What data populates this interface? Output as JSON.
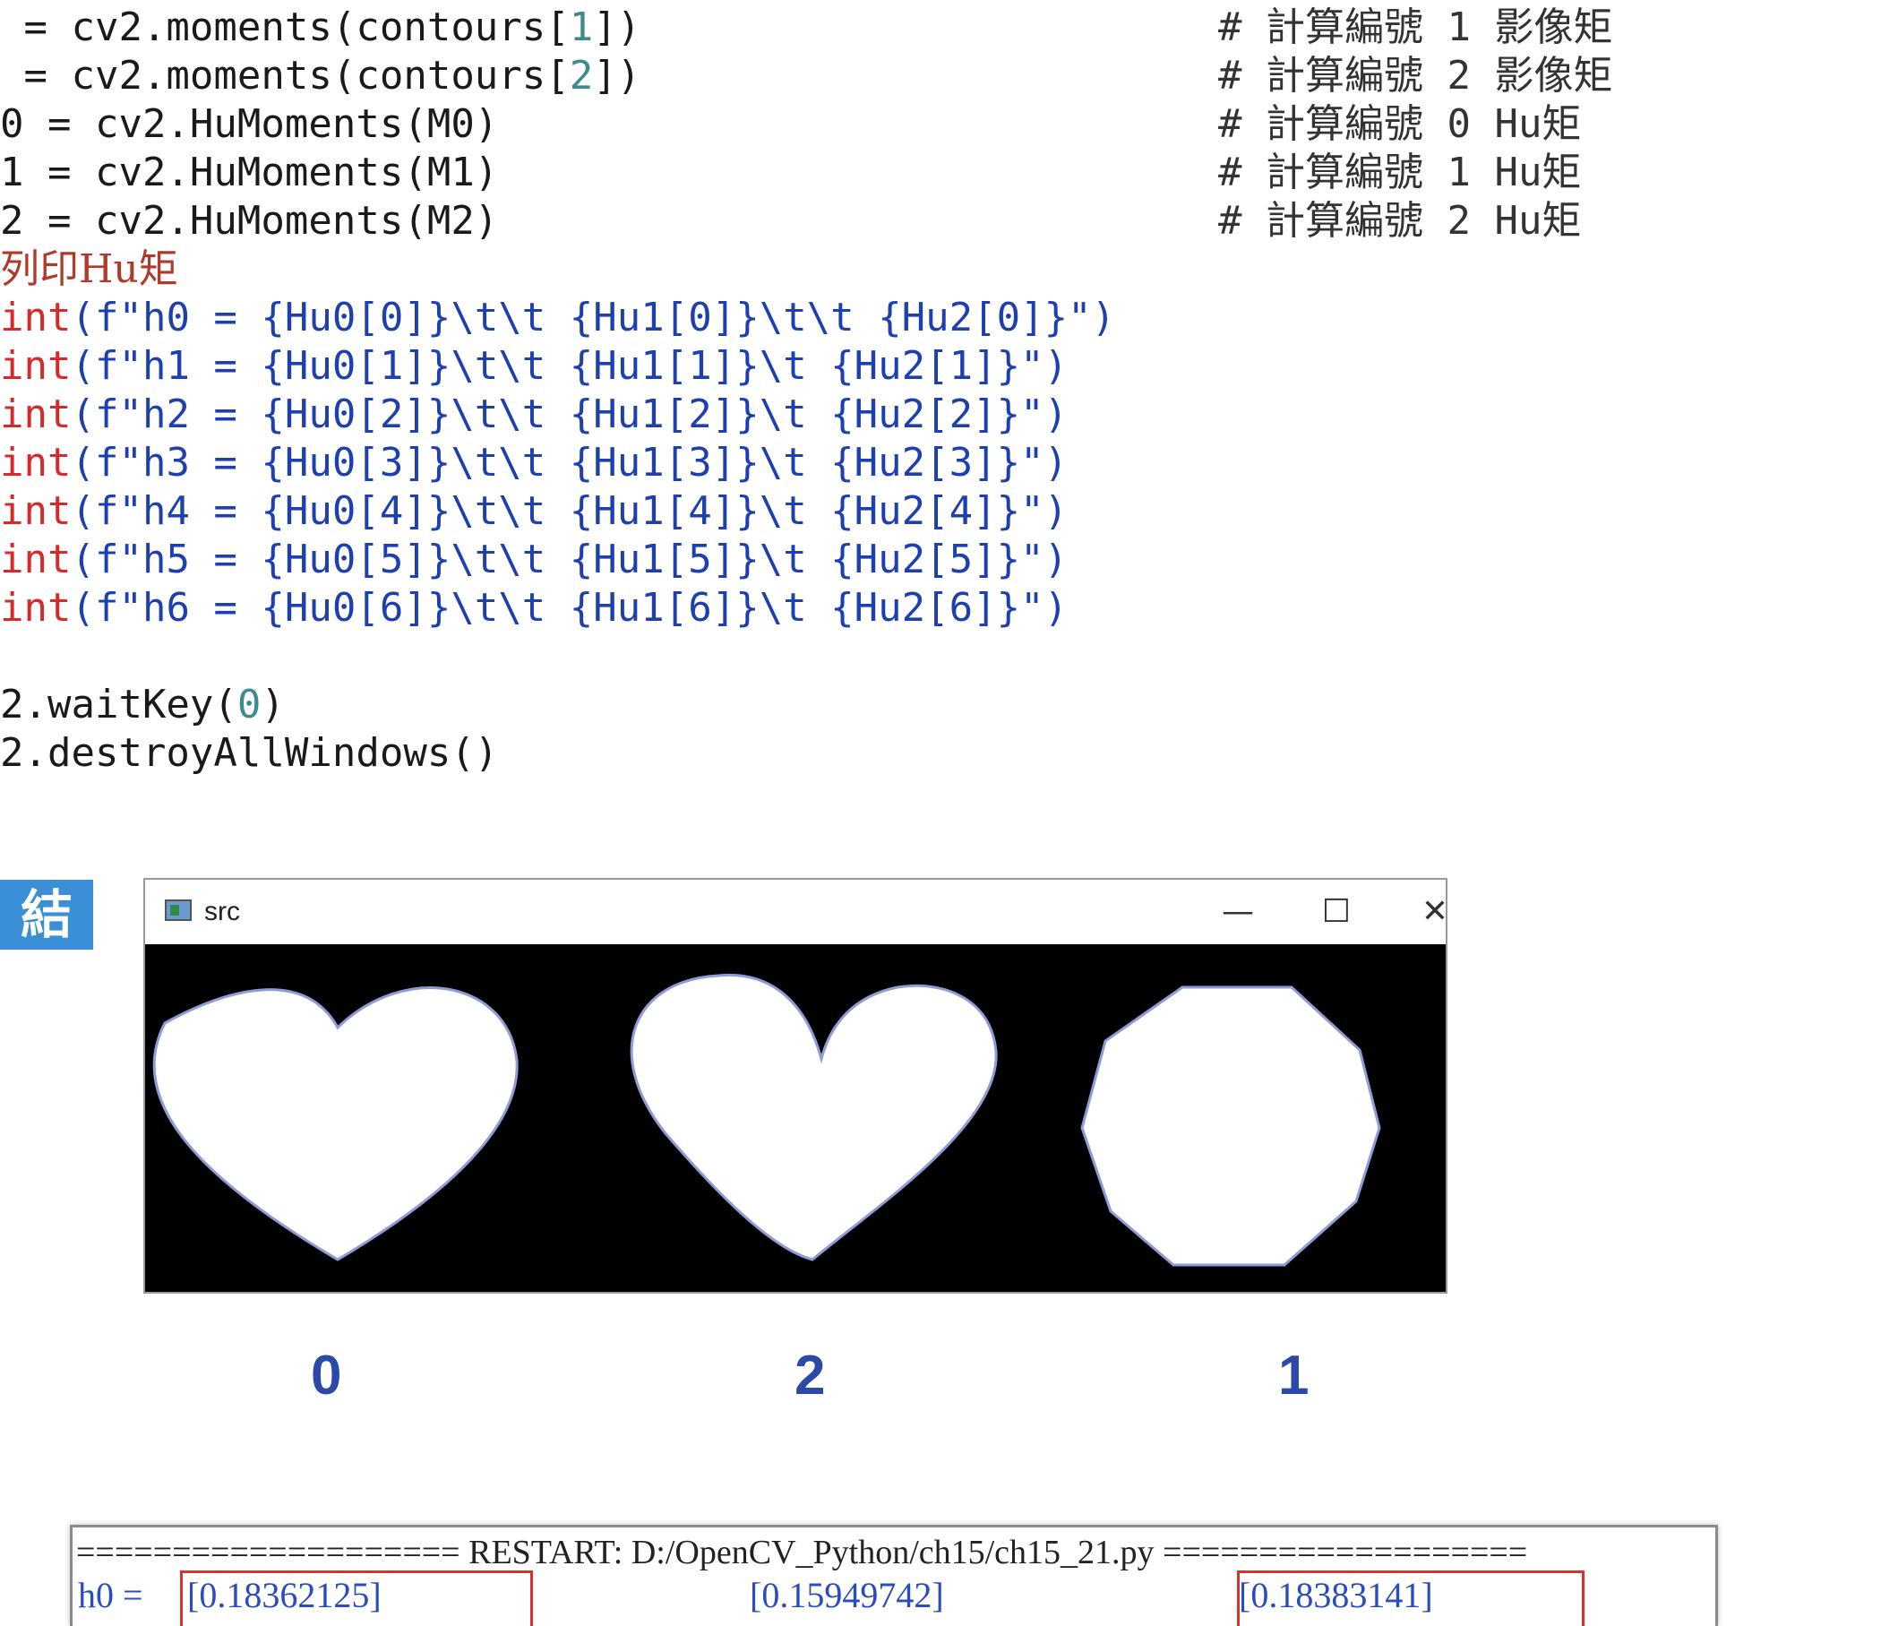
{
  "code": {
    "lines": [
      {
        "plain_pre": " = cv2.moments(contours[",
        "num": "1",
        "plain_post": "])"
      },
      {
        "plain_pre": " = cv2.moments(contours[",
        "num": "2",
        "plain_post": "])"
      },
      {
        "text": "0 = cv2.HuMoments(M0)"
      },
      {
        "text": "1 = cv2.HuMoments(M1)"
      },
      {
        "text": "2 = cv2.HuMoments(M2)"
      },
      {
        "comment": "列印Hu矩"
      },
      {
        "kw": "int",
        "rest": "(f\"h0 = {Hu0[0]}\\t\\t {Hu1[0]}\\t\\t {Hu2[0]}\")"
      },
      {
        "kw": "int",
        "rest": "(f\"h1 = {Hu0[1]}\\t\\t {Hu1[1]}\\t {Hu2[1]}\")"
      },
      {
        "kw": "int",
        "rest": "(f\"h2 = {Hu0[2]}\\t\\t {Hu1[2]}\\t {Hu2[2]}\")"
      },
      {
        "kw": "int",
        "rest": "(f\"h3 = {Hu0[3]}\\t\\t {Hu1[3]}\\t {Hu2[3]}\")"
      },
      {
        "kw": "int",
        "rest": "(f\"h4 = {Hu0[4]}\\t\\t {Hu1[4]}\\t {Hu2[4]}\")"
      },
      {
        "kw": "int",
        "rest": "(f\"h5 = {Hu0[5]}\\t\\t {Hu1[5]}\\t {Hu2[5]}\")"
      },
      {
        "kw": "int",
        "rest": "(f\"h6 = {Hu0[6]}\\t\\t {Hu1[6]}\\t {Hu2[6]}\")"
      },
      {
        "text": ""
      },
      {
        "plain_pre": "2.waitKey(",
        "num": "0",
        "plain_post": ")"
      },
      {
        "text": "2.destroyAllWindows()"
      }
    ],
    "comments": [
      "# 計算編號 1 影像矩",
      "# 計算編號 2 影像矩",
      "# 計算編號 0 Hu矩",
      "# 計算編號 1 Hu矩",
      "# 計算編號 2 Hu矩"
    ]
  },
  "result_badge": "結果",
  "window": {
    "title": "src",
    "minimize": "—",
    "maximize": "☐",
    "close": "✕",
    "shapes": [
      "heart",
      "heart",
      "octagon"
    ]
  },
  "shape_labels": [
    "0",
    "2",
    "1"
  ],
  "console": {
    "restart_line": "==================== RESTART: D:/OpenCV_Python/ch15/ch15_21.py ===================",
    "row_label": "h0 = ",
    "values": [
      "[0.18362125]",
      "[0.15949742]",
      "[0.18383141]"
    ]
  },
  "colors": {
    "keyword": "#d42a2a",
    "string_expr": "#1d3fb0",
    "number": "#3c8c8c",
    "comment": "#b03a2a",
    "badge": "#3a8fd6",
    "label": "#2b4aa8",
    "highlight": "#d93030"
  }
}
